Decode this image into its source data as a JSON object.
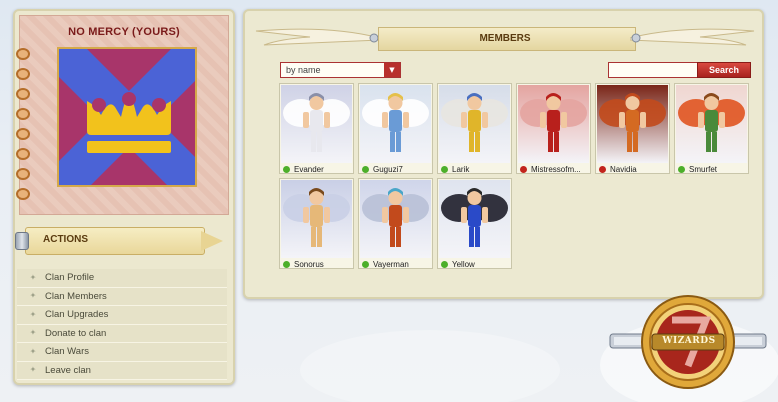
{
  "clan": {
    "name": "NO MERCY (YOURS)",
    "emblem": {
      "name": "crown-emblem",
      "background": "#a8356a",
      "cross_color": "#4b63d6",
      "crown_color": "#f2c21c"
    }
  },
  "actions": {
    "title": "ACTIONS",
    "items": [
      {
        "label": "Clan Profile",
        "icon": "bullet-icon"
      },
      {
        "label": "Clan Members",
        "icon": "bullet-icon"
      },
      {
        "label": "Clan Upgrades",
        "icon": "bullet-icon"
      },
      {
        "label": "Donate to clan",
        "icon": "bullet-icon"
      },
      {
        "label": "Clan Wars",
        "icon": "bullet-icon"
      },
      {
        "label": "Leave clan",
        "icon": "bullet-icon"
      }
    ]
  },
  "members": {
    "title": "MEMBERS",
    "sort": {
      "selected": "by name"
    },
    "search": {
      "value": "",
      "button_label": "Search"
    },
    "list": [
      {
        "name": "Evander",
        "online": true,
        "bg": "#cfd2e6",
        "wing": "#ffffff",
        "armor": "#e8e8ee",
        "hair": "#8a8fa8"
      },
      {
        "name": "Guguzi7",
        "online": true,
        "bg": "#d9e2ee",
        "wing": "#ffffff",
        "armor": "#6a9bd6",
        "hair": "#e5c04a"
      },
      {
        "name": "Larik",
        "online": true,
        "bg": "#d6dde9",
        "wing": "#e8e6e0",
        "armor": "#e0b52a",
        "hair": "#4a6fc0"
      },
      {
        "name": "Mistressofm...",
        "online": false,
        "bg": "#e4a4a0",
        "wing": "#e4a4a0",
        "armor": "#b8201c",
        "hair": "#b8201c"
      },
      {
        "name": "Navidia",
        "online": false,
        "bg": "#7a2618",
        "wing": "#c24a1c",
        "armor": "#d46a22",
        "hair": "#c24a1c"
      },
      {
        "name": "Smurfet",
        "online": true,
        "bg": "#efd6d0",
        "wing": "#e05420",
        "armor": "#4a8a3a",
        "hair": "#8a4a1c"
      },
      {
        "name": "Sonorus",
        "online": true,
        "bg": "#c9cfe6",
        "wing": "#c9cfe6",
        "armor": "#e6b878",
        "hair": "#7a4a1c"
      },
      {
        "name": "Vayerman",
        "online": true,
        "bg": "#cfd5ea",
        "wing": "#b8c0d6",
        "armor": "#c24a1c",
        "hair": "#4aa6c8"
      },
      {
        "name": "Yellow",
        "online": true,
        "bg": "#dfe4ef",
        "wing": "#1e1e2a",
        "armor": "#2a4ac8",
        "hair": "#2a2a2a"
      }
    ]
  },
  "status_colors": {
    "online": "#4caf2a",
    "offline": "#c2241c"
  },
  "logo": {
    "text": "WIZARDS",
    "numeral": "7",
    "ring_color": "#e0a83a",
    "center_color": "#a8261c"
  }
}
